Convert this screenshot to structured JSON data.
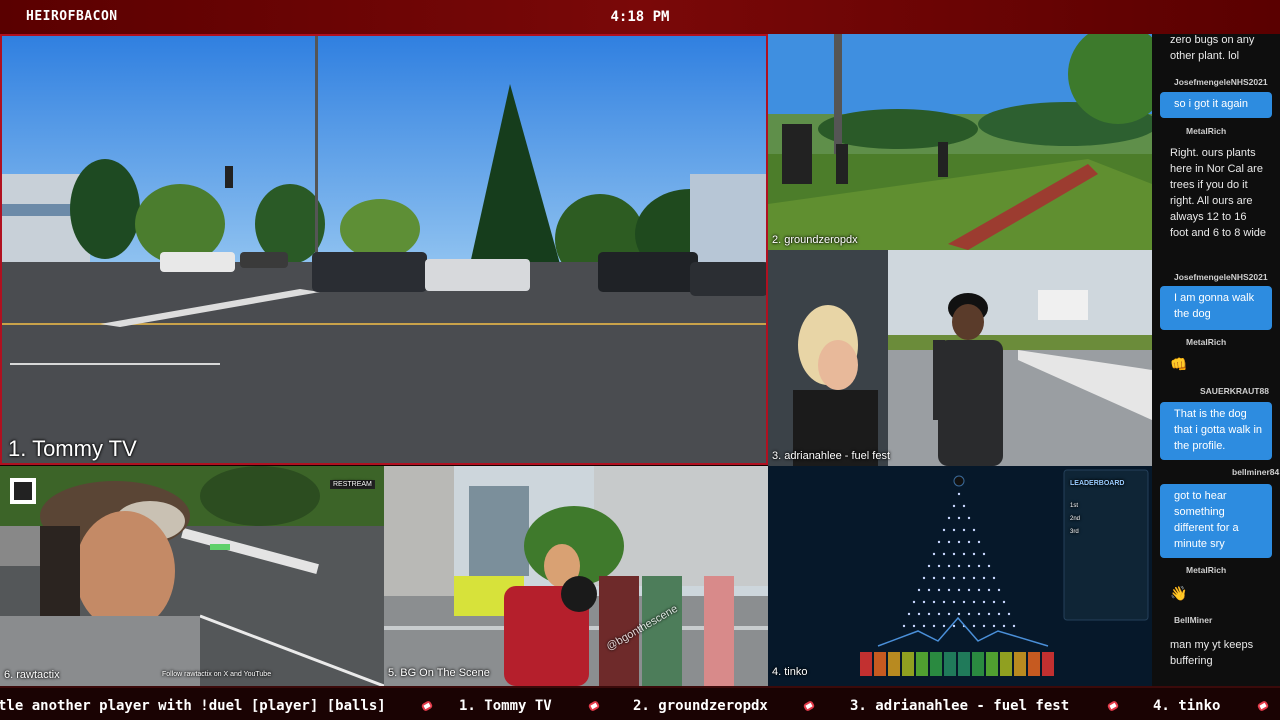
{
  "header": {
    "channel": "HEIROFBACON",
    "time": "4:18 PM"
  },
  "streams": {
    "s1": "1. Tommy TV",
    "s2": "2. groundzeropdx",
    "s3": "3. adrianahlee - fuel fest",
    "s4": "4. tinko",
    "s5": "5. BG On The Scene",
    "s6": "6. rawtactix"
  },
  "overlays": {
    "restream": "RESTREAM",
    "follow_text": "Follow rawtactix on X and YouTube",
    "watermark": "@bgonthescene",
    "leaderboard_title": "LEADERBOARD",
    "leaderboard_ranks": [
      "1st",
      "2nd",
      "3rd"
    ]
  },
  "chat": {
    "messages": [
      {
        "user": "",
        "text": "zero bugs on any other plant. lol",
        "style": "dark"
      },
      {
        "user": "JosefmengeleNHS2021",
        "text": "so i got it again",
        "style": "bubble"
      },
      {
        "user": "MetalRich",
        "text": "Right. ours plants here in Nor Cal are trees if you do it right. All ours are always 12 to 16 foot and 6 to 8 wide",
        "style": "dark"
      },
      {
        "user": "JosefmengeleNHS2021",
        "text": "I am gonna walk the dog",
        "style": "bubble"
      },
      {
        "user": "MetalRich",
        "text": "👊",
        "style": "dark"
      },
      {
        "user": "SAUERKRAUT88",
        "text": "That is the dog that i gotta walk in the profile.",
        "style": "bubble"
      },
      {
        "user": "bellminer84",
        "text": "got to hear something different for a minute sry",
        "style": "bubble"
      },
      {
        "user": "MetalRich",
        "text": "👋",
        "style": "dark"
      },
      {
        "user": "BellMiner",
        "text": "man my yt keeps buffering",
        "style": "dark"
      }
    ]
  },
  "ticker": {
    "items": [
      "tle another player with !duel [player] [balls]",
      "1. Tommy TV",
      "2. groundzeropdx",
      "3. adrianahlee - fuel fest",
      "4. tinko"
    ]
  },
  "colors": {
    "accent": "#b01020",
    "chat_bubble": "#2d8ce0",
    "ticker_bg": "#1a0303"
  }
}
